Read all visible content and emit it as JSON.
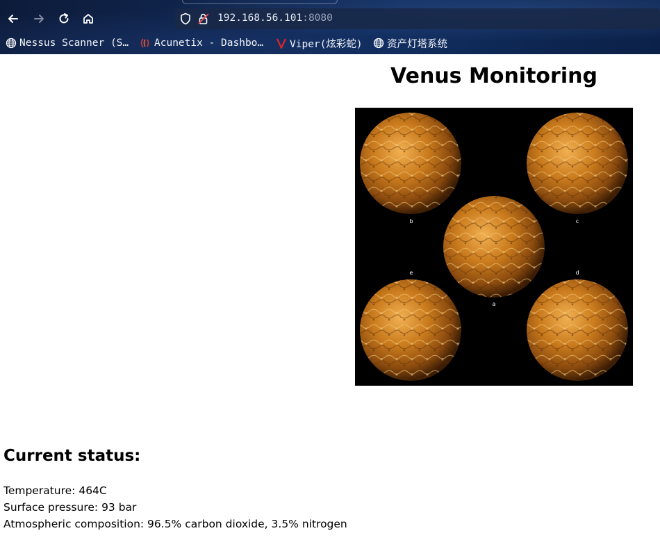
{
  "browser": {
    "url": {
      "host": "192.168.56.101",
      "port": ":8080"
    },
    "bookmarks": [
      {
        "label": "Nessus Scanner (S…",
        "icon": "globe-icon"
      },
      {
        "label": "Acunetix - Dashbo…",
        "icon": "acunetix-icon"
      },
      {
        "label": "Viper(炫彩蛇)",
        "icon": "viper-icon"
      },
      {
        "label": "资产灯塔系统",
        "icon": "globe-icon"
      }
    ]
  },
  "page": {
    "title": "Venus Monitoring",
    "image": {
      "labels": [
        "b",
        "c",
        "e",
        "d",
        "a"
      ]
    },
    "status": {
      "heading": "Current status:",
      "temperature": "Temperature: 464C",
      "pressure": "Surface pressure: 93 bar",
      "composition": "Atmospheric composition: 96.5% carbon dioxide, 3.5% nitrogen"
    }
  },
  "colors": {
    "chrome_bg": "#0f2a58",
    "url_bar": "#19284a",
    "viper_red": "#e0242a",
    "planet": "#c47a1e"
  }
}
